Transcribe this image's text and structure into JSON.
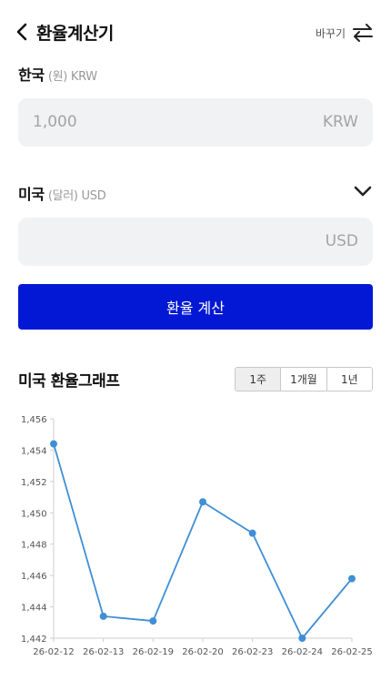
{
  "header": {
    "title": "환율계산기",
    "swap_label": "바꾸기"
  },
  "from_currency": {
    "name": "한국",
    "detail": "(원) KRW",
    "value": "1,000",
    "unit": "KRW"
  },
  "to_currency": {
    "name": "미국",
    "detail": "(달러) USD",
    "value": "",
    "unit": "USD"
  },
  "calc_button": {
    "label": "환율 계산"
  },
  "graph": {
    "title": "미국 환율그래프",
    "periods": [
      {
        "label": "1주",
        "selected": true
      },
      {
        "label": "1개월",
        "selected": false
      },
      {
        "label": "1년",
        "selected": false
      }
    ]
  },
  "colors": {
    "accent": "#0218d4",
    "line": "#3f8fd6"
  },
  "chart_data": {
    "type": "line",
    "x": [
      "26-02-12",
      "26-02-13",
      "26-02-19",
      "26-02-20",
      "26-02-23",
      "26-02-24",
      "26-02-25"
    ],
    "series": [
      {
        "values": [
          1454.4,
          1443.4,
          1443.1,
          1450.7,
          1448.7,
          1442.0,
          1445.8
        ]
      }
    ],
    "ylim": [
      1442,
      1456
    ],
    "yticks": [
      "1,442",
      "1,444",
      "1,446",
      "1,448",
      "1,450",
      "1,452",
      "1,454",
      "1,456"
    ],
    "grid": false,
    "legend": "none"
  }
}
